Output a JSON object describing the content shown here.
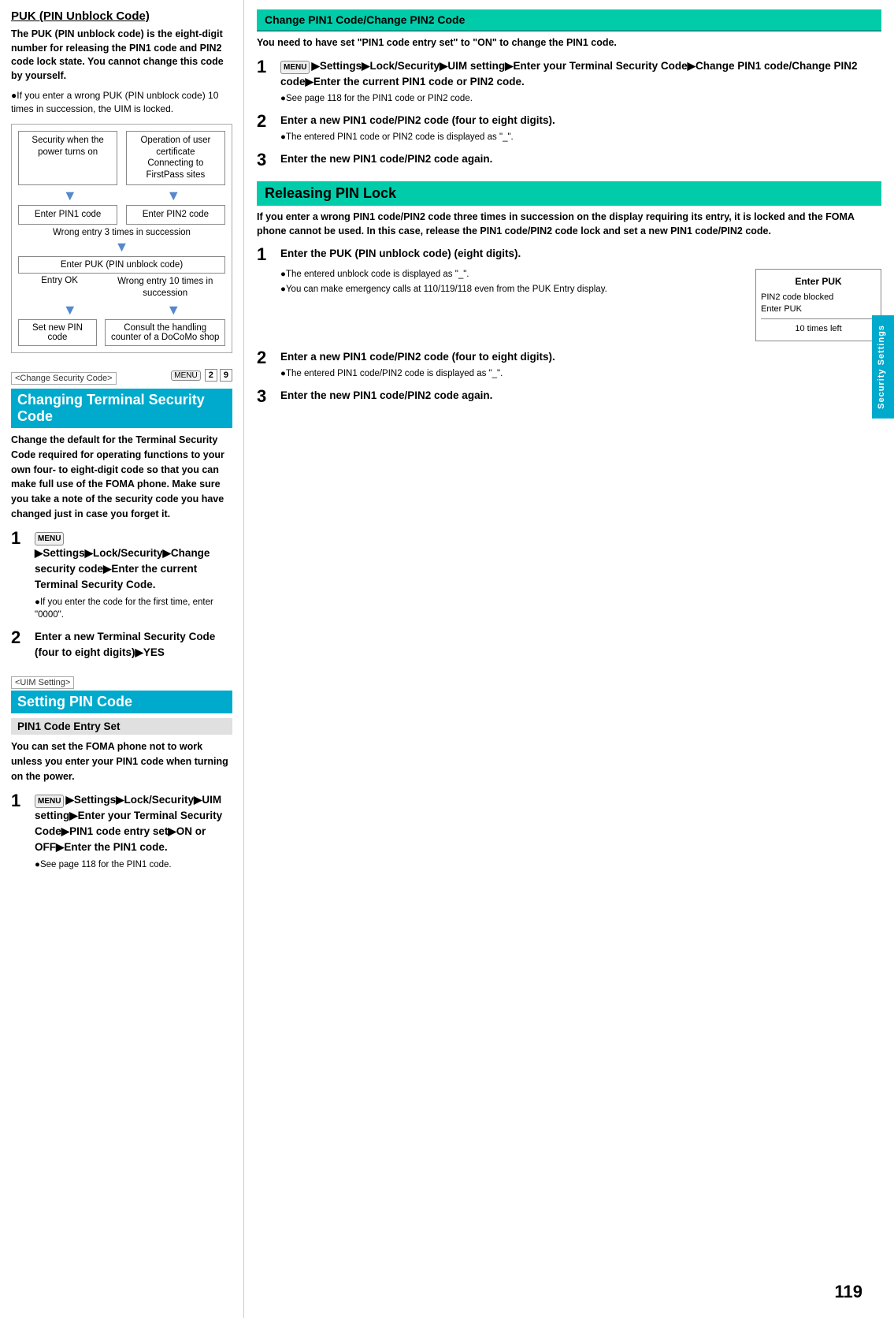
{
  "page": {
    "number": "119",
    "side_tab": "Security Settings"
  },
  "left_col": {
    "puk_section": {
      "title": "PUK (PIN Unblock Code)",
      "body": "The PUK (PIN unblock code) is the eight-digit number for releasing the PIN1 code and PIN2 code lock state. You cannot change this code by yourself.",
      "bullet": "●If you enter a wrong PUK (PIN unblock code) 10 times in succession, the UIM is locked.",
      "diagram": {
        "box1": "Security when the power turns on",
        "box2": "Operation of user certificate Connecting to FirstPass sites",
        "arrow": "▼",
        "box3": "Enter PIN1 code",
        "box4": "Enter PIN2 code",
        "wrong_entry": "Wrong entry 3 times in succession",
        "puk_box": "Enter PUK (PIN unblock code)",
        "entry_ok": "Entry OK",
        "wrong10": "Wrong entry 10 times in succession",
        "set_new": "Set new PIN code",
        "consult": "Consult the handling counter of a DoCoMo shop"
      }
    },
    "change_security_section": {
      "tag": "<Change Security Code>",
      "menu_label": "MENU",
      "menu_num1": "2",
      "menu_num2": "9",
      "header": "Changing Terminal Security Code",
      "description": "Change the default for the Terminal Security Code required for operating functions to your own four- to eight-digit code so that you can make full use of the FOMA phone. Make sure you take a note of the security code you have changed just in case you forget it.",
      "step1": {
        "number": "1",
        "title": "▶Settings▶Lock/Security▶Change security code▶Enter the current Terminal Security Code.",
        "sub": "●If you enter the code for the first time, enter \"0000\"."
      },
      "step2": {
        "number": "2",
        "title": "Enter a new Terminal Security Code (four to eight digits)▶YES"
      }
    },
    "uim_section": {
      "tag": "<UIM Setting>",
      "header": "Setting PIN Code",
      "subsection": "PIN1 Code Entry Set",
      "desc": "You can set the FOMA phone not to work unless you enter your PIN1 code when turning on the power.",
      "step1": {
        "number": "1",
        "title": "▶Settings▶Lock/Security▶UIM setting▶Enter your Terminal Security Code▶PIN1 code entry set▶ON or OFF▶Enter the PIN1 code.",
        "sub": "●See page 118 for the PIN1 code."
      }
    }
  },
  "right_col": {
    "change_pin_section": {
      "header": "Change PIN1 Code/Change PIN2 Code",
      "desc": "You need to have set \"PIN1 code entry set\" to \"ON\" to change the PIN1 code.",
      "step1": {
        "number": "1",
        "title": "▶Settings▶Lock/Security▶UIM setting▶Enter your Terminal Security Code▶Change PIN1 code/Change PIN2 code▶Enter the current PIN1 code or PIN2 code.",
        "sub": "●See page 118 for the PIN1 code or PIN2 code."
      },
      "step2": {
        "number": "2",
        "title": "Enter a new PIN1 code/PIN2 code (four to eight digits).",
        "sub": "●The entered PIN1 code or PIN2 code is displayed as \"_\"."
      },
      "step3": {
        "number": "3",
        "title": "Enter the new PIN1 code/PIN2 code again."
      }
    },
    "releasing_section": {
      "header": "Releasing PIN Lock",
      "desc": "If you enter a wrong PIN1 code/PIN2 code three times in succession on the display requiring its entry, it is locked and the FOMA phone cannot be used. In this case, release the PIN1 code/PIN2 code lock and set a new PIN1 code/PIN2 code.",
      "step1": {
        "number": "1",
        "title": "Enter the PUK (PIN unblock code) (eight digits).",
        "sub1": "●The entered unblock code is displayed as \"_\".",
        "sub2": "●You can make emergency calls at 110/119/118 even from the PUK Entry display.",
        "puk_box": {
          "title": "Enter PUK",
          "line1": "PIN2 code blocked",
          "line2": "Enter PUK",
          "separator": true,
          "bottom": "10 times left"
        }
      },
      "step2": {
        "number": "2",
        "title": "Enter a new PIN1 code/PIN2 code (four to eight digits).",
        "sub": "●The entered PIN1 code/PIN2 code is displayed as \"_\"."
      },
      "step3": {
        "number": "3",
        "title": "Enter the new PIN1 code/PIN2 code again."
      }
    }
  }
}
